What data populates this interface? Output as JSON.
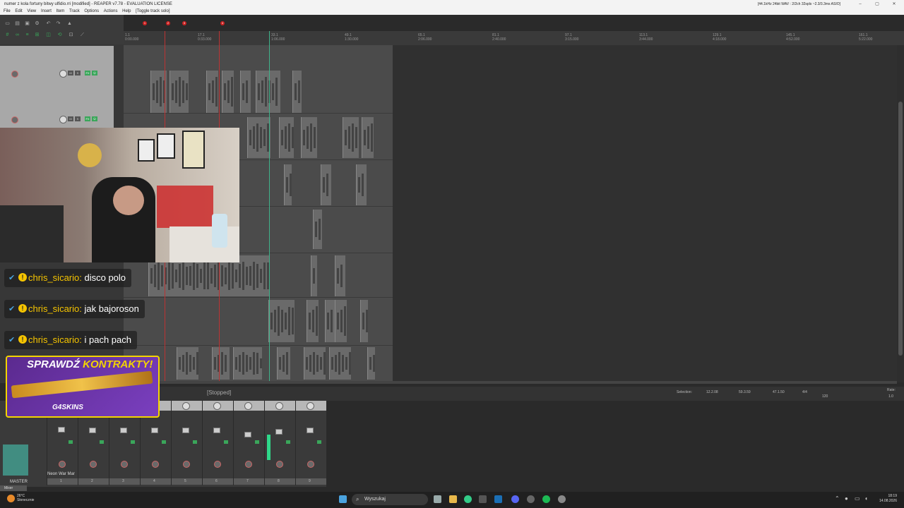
{
  "window": {
    "title": "numer z kola fortuny bitwy ulfidio.rri [modified] - REAPER v7.78 - EVALUATION LICENSE",
    "audio_info": "[44.1kHz 24bit WAV : 2/2ch 32spls ~2.3/3.3ms ASIO]"
  },
  "menu": {
    "items": [
      "File",
      "Edit",
      "View",
      "Insert",
      "Item",
      "Track",
      "Options",
      "Actions",
      "Help",
      "[Toggle track solo]"
    ]
  },
  "ruler": {
    "ticks": [
      {
        "bar": "1.1",
        "time": "0:00.000"
      },
      {
        "bar": "17.1",
        "time": "0:33.000"
      },
      {
        "bar": "33.1",
        "time": "1:06.000"
      },
      {
        "bar": "49.1",
        "time": "1:30.000"
      },
      {
        "bar": "65.1",
        "time": "2:06.000"
      },
      {
        "bar": "81.1",
        "time": "2:40.000"
      },
      {
        "bar": "97.1",
        "time": "3:15.000"
      },
      {
        "bar": "113.1",
        "time": "3:44.000"
      },
      {
        "bar": "129.1",
        "time": "4:18.000"
      },
      {
        "bar": "145.1",
        "time": "4:52.000"
      },
      {
        "bar": "161.1",
        "time": "5:22.000"
      }
    ],
    "markers": [
      "1",
      "2",
      "3",
      "4"
    ]
  },
  "transport": {
    "status": "[Stopped]",
    "selection_label": "Selection:",
    "selection_start": "12.2.08",
    "selection_end": "59.3.59",
    "selection_length": "47.1.50",
    "time_sig": "4/4",
    "bpm": "120",
    "rate_label": "Rate:",
    "rate_value": "1.0"
  },
  "mixer": {
    "master_label": "MASTER",
    "mixer_tab": "Mixer",
    "track_name": "Neon War Mar",
    "strip_numbers": [
      "1",
      "2",
      "3",
      "4",
      "5",
      "6",
      "7",
      "8",
      "9"
    ]
  },
  "chat": [
    {
      "user": "chris_sicario:",
      "message": "disco polo"
    },
    {
      "user": "chris_sicario:",
      "message": "jak bajoroson"
    },
    {
      "user": "chris_sicario:",
      "message": "i pach pach"
    }
  ],
  "promo": {
    "headline_a": "SPRAWDŹ",
    "headline_b": "KONTRAKTY!",
    "brand": "G4SKINS"
  },
  "taskbar": {
    "search_placeholder": "Wyszukaj",
    "weather_temp": "26°C",
    "weather_desc": "Słonecznie",
    "time": "18:19",
    "date": "14.08.2026"
  },
  "colors": {
    "accent_green": "#3aa65a",
    "marker_red": "#c22222",
    "chat_user": "#f5c400",
    "playhead": "#3fb28a"
  }
}
